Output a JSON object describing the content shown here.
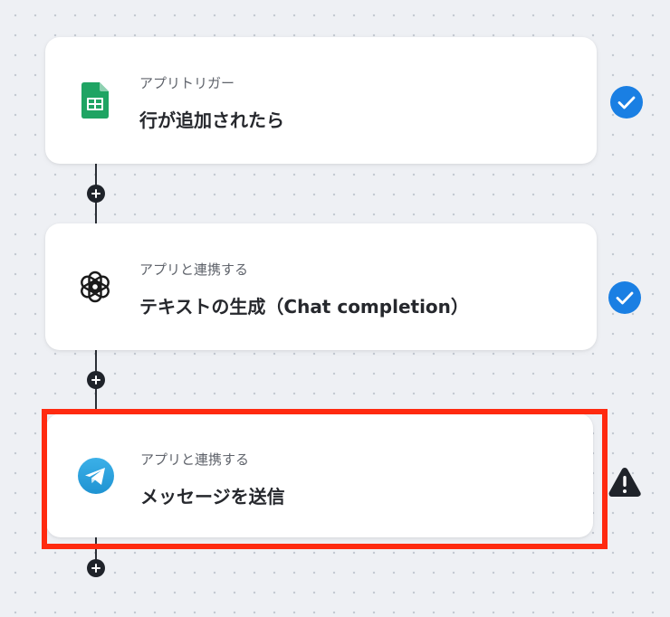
{
  "colors": {
    "accent_blue": "#1a7fe3",
    "highlight_red": "#ff2a10",
    "sheets_green": "#1fa463",
    "telegram_blue": "#2aa1da",
    "warning_dark": "#1f232a"
  },
  "steps": [
    {
      "icon": "google-sheets-icon",
      "subtitle": "アプリトリガー",
      "title": "行が追加されたら",
      "status": "check-circle-icon"
    },
    {
      "icon": "openai-icon",
      "subtitle": "アプリと連携する",
      "title": "テキストの生成（Chat completion）",
      "status": "check-circle-icon"
    },
    {
      "icon": "telegram-icon",
      "subtitle": "アプリと連携する",
      "title": "メッセージを送信",
      "status": "warning-triangle-icon",
      "selected": true
    }
  ],
  "add_buttons": [
    "plus-icon",
    "plus-icon",
    "plus-icon"
  ]
}
